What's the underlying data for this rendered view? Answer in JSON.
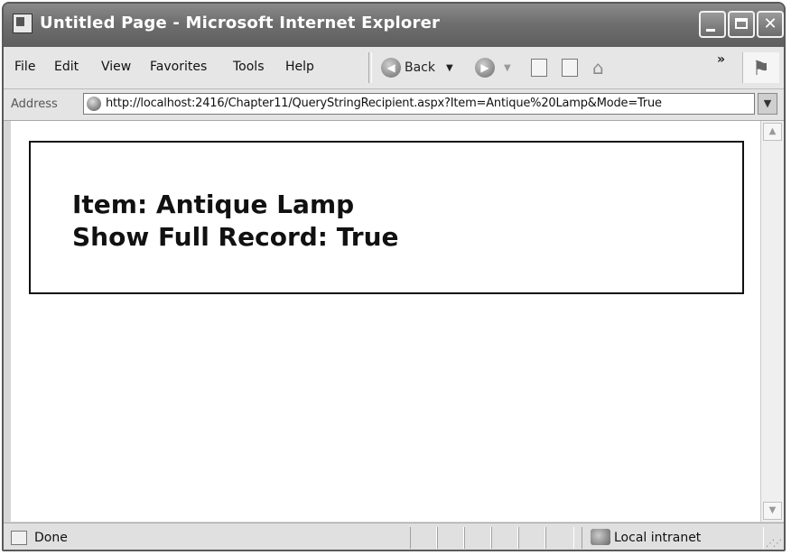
{
  "window": {
    "title": "Untitled Page - Microsoft Internet Explorer"
  },
  "menu": {
    "items": [
      "File",
      "Edit",
      "View",
      "Favorites",
      "Tools",
      "Help"
    ]
  },
  "toolbar": {
    "back_label": "Back",
    "more": "»"
  },
  "address": {
    "label": "Address",
    "url": "http://localhost:2416/Chapter11/QueryStringRecipient.aspx?Item=Antique%20Lamp&Mode=True"
  },
  "page": {
    "item_line": "Item: Antique Lamp",
    "record_line": "Show Full Record: True"
  },
  "status": {
    "text": "Done",
    "zone": "Local intranet"
  }
}
